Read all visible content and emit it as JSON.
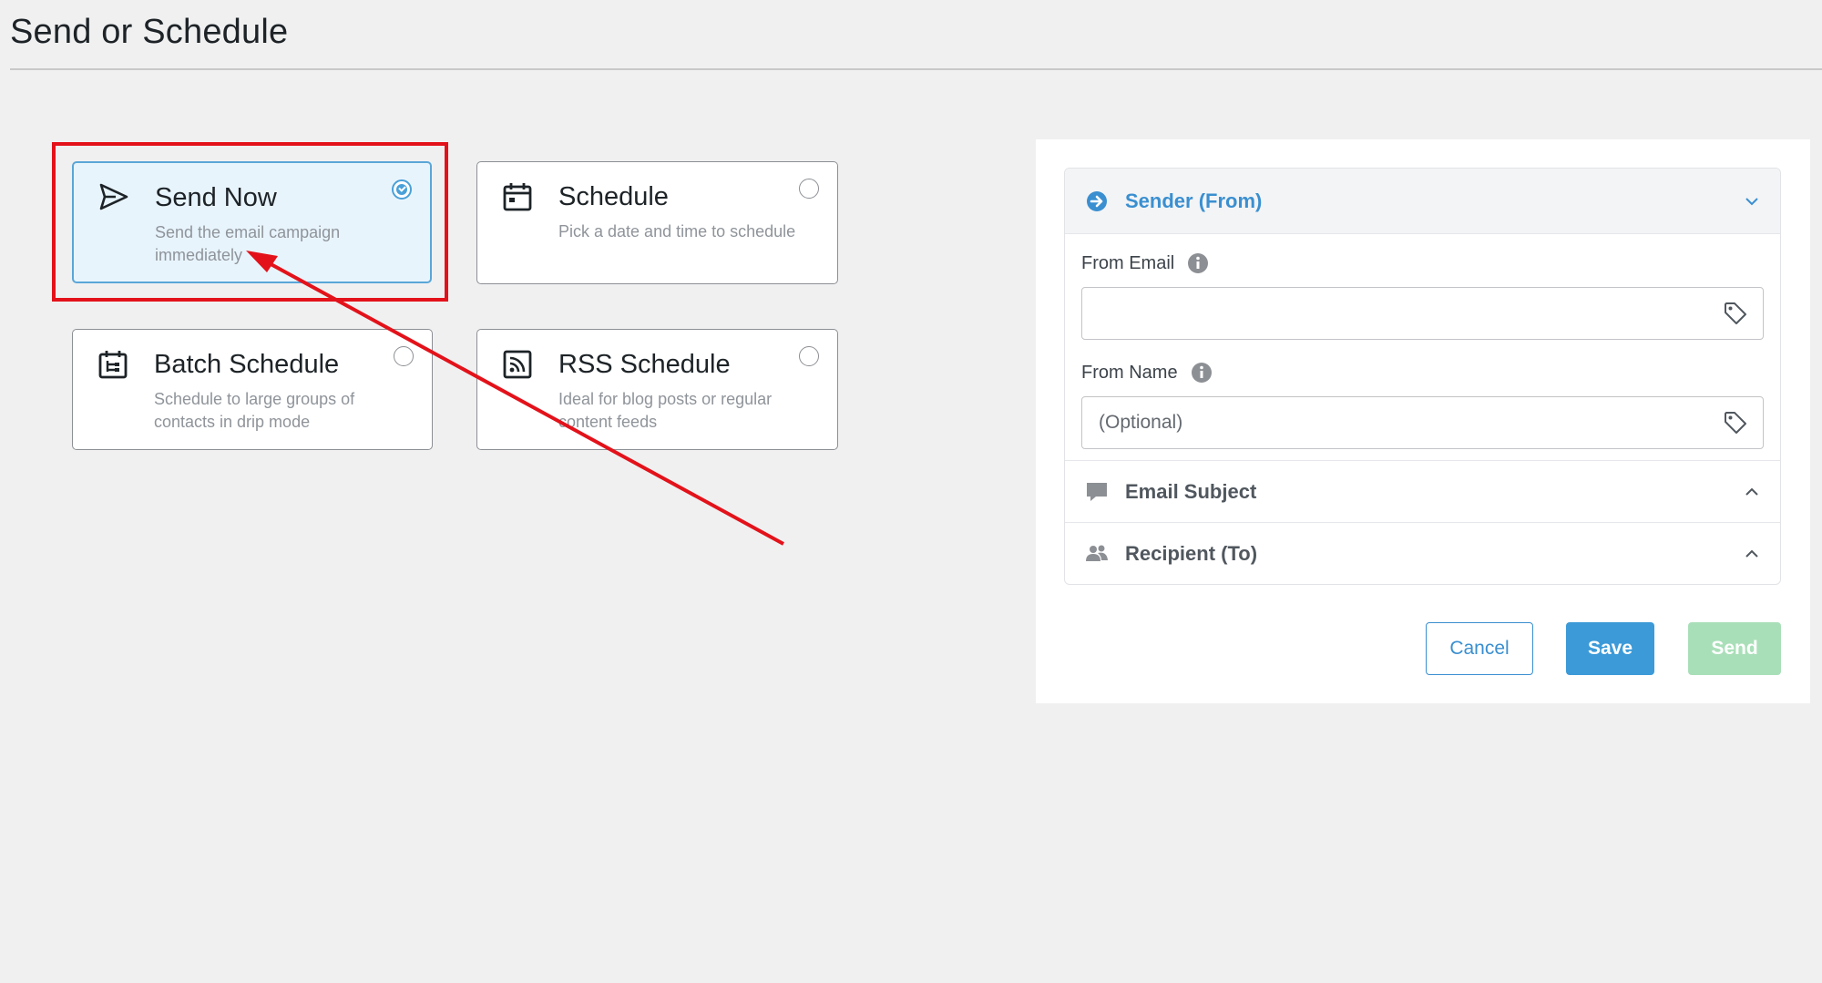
{
  "page": {
    "title": "Send or Schedule"
  },
  "options": [
    {
      "title": "Send Now",
      "description": "Send the email campaign immediately",
      "icon": "send-icon",
      "selected": true
    },
    {
      "title": "Schedule",
      "description": "Pick a date and time to schedule",
      "icon": "calendar-icon",
      "selected": false
    },
    {
      "title": "Batch Schedule",
      "description": "Schedule to large groups of contacts in drip mode",
      "icon": "batch-calendar-icon",
      "selected": false
    },
    {
      "title": "RSS Schedule",
      "description": "Ideal for blog posts or regular content feeds",
      "icon": "rss-icon",
      "selected": false
    }
  ],
  "panel": {
    "sender": {
      "title": "Sender (From)",
      "icon": "arrow-circle-right-icon",
      "from_email": {
        "label": "From Email",
        "value": "",
        "placeholder": ""
      },
      "from_name": {
        "label": "From Name",
        "value": "",
        "placeholder": "(Optional)"
      }
    },
    "subject": {
      "title": "Email Subject",
      "icon": "comment-icon"
    },
    "recipient": {
      "title": "Recipient (To)",
      "icon": "users-icon"
    }
  },
  "buttons": {
    "cancel": "Cancel",
    "save": "Save",
    "send": "Send"
  },
  "colors": {
    "accent": "#3a8fd0",
    "highlight": "#e3121a",
    "send_disabled": "#a9dfb8",
    "selected_card_bg": "#e8f4fc"
  }
}
